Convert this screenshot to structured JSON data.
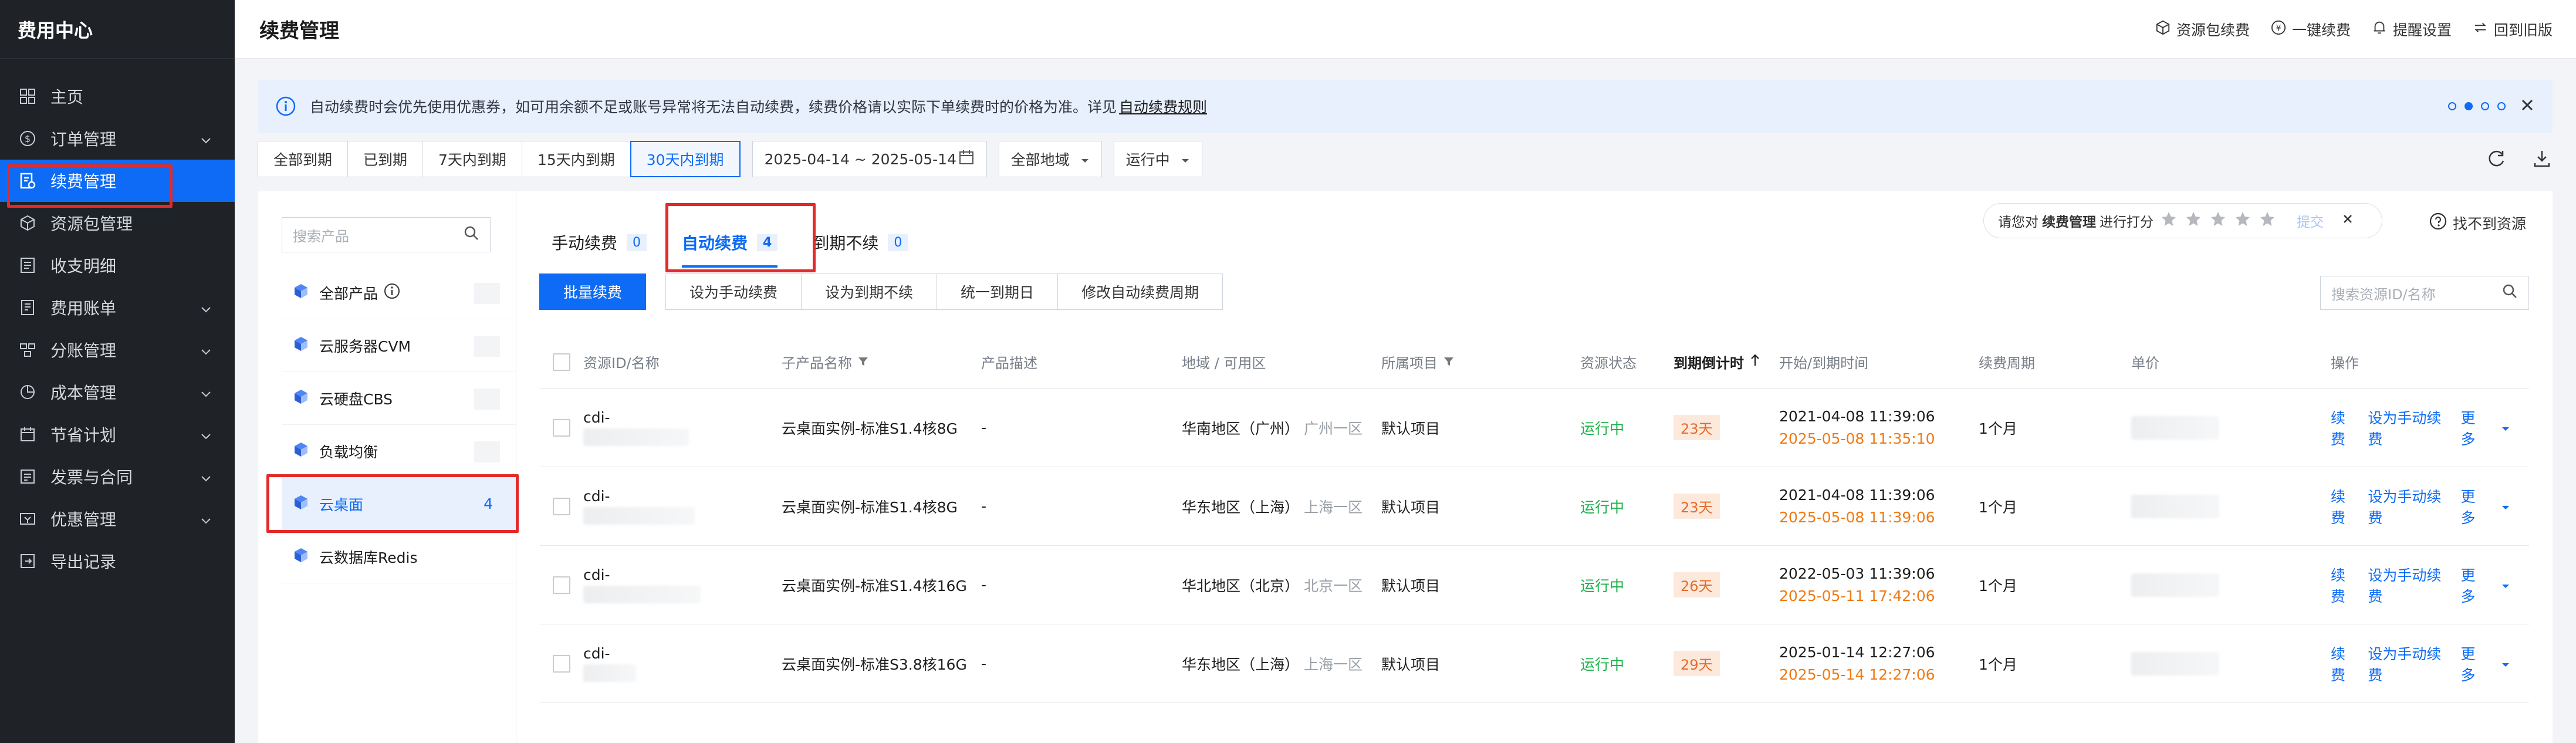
{
  "sidebar": {
    "title": "费用中心",
    "items": [
      {
        "label": "主页",
        "icon": "grid-icon",
        "chevron": false
      },
      {
        "label": "订单管理",
        "icon": "dollar-circle-icon",
        "chevron": true
      },
      {
        "label": "续费管理",
        "icon": "renew-doc-icon",
        "chevron": false,
        "active": true
      },
      {
        "label": "资源包管理",
        "icon": "cube-icon",
        "chevron": false
      },
      {
        "label": "收支明细",
        "icon": "list-icon",
        "chevron": false
      },
      {
        "label": "费用账单",
        "icon": "bill-icon",
        "chevron": true
      },
      {
        "label": "分账管理",
        "icon": "split-icon",
        "chevron": true
      },
      {
        "label": "成本管理",
        "icon": "pie-icon",
        "chevron": true
      },
      {
        "label": "节省计划",
        "icon": "calendar-icon",
        "chevron": true
      },
      {
        "label": "发票与合同",
        "icon": "invoice-icon",
        "chevron": true
      },
      {
        "label": "优惠管理",
        "icon": "coupon-icon",
        "chevron": true
      },
      {
        "label": "导出记录",
        "icon": "export-icon",
        "chevron": false
      }
    ]
  },
  "header": {
    "title": "续费管理",
    "actions": [
      {
        "label": "资源包续费",
        "icon": "cube-icon"
      },
      {
        "label": "一键续费",
        "icon": "coin-icon"
      },
      {
        "label": "提醒设置",
        "icon": "bell-icon"
      },
      {
        "label": "回到旧版",
        "icon": "switch-icon"
      }
    ]
  },
  "notice": {
    "text": "自动续费时会优先使用优惠券，如可用余额不足或账号异常将无法自动续费，续费价格请以实际下单续费时的价格为准。详见",
    "link": "自动续费规则"
  },
  "filters": {
    "periods": [
      "全部到期",
      "已到期",
      "7天内到期",
      "15天内到期",
      "30天内到期"
    ],
    "active_period": 4,
    "date_range": "2025-04-14  ~ 2025-05-14",
    "region": "全部地域",
    "status": "运行中"
  },
  "products": {
    "search_placeholder": "搜索产品",
    "items": [
      {
        "label": "全部产品",
        "count": ""
      },
      {
        "label": "云服务器CVM",
        "count": ""
      },
      {
        "label": "云硬盘CBS",
        "count": ""
      },
      {
        "label": "负载均衡",
        "count": ""
      },
      {
        "label": "云桌面",
        "count": "4",
        "selected": true
      },
      {
        "label": "云数据库Redis",
        "count": ""
      }
    ]
  },
  "tabs": [
    {
      "label": "手动续费",
      "count": "0"
    },
    {
      "label": "自动续费",
      "count": "4",
      "active": true
    },
    {
      "label": "到期不续",
      "count": "0"
    }
  ],
  "rating": {
    "prefix": "请您对",
    "subject": "续费管理",
    "suffix": "进行打分",
    "submit": "提交"
  },
  "missing_resource": "找不到资源",
  "buttons": [
    "批量续费",
    "设为手动续费",
    "设为到期不续",
    "统一到期日",
    "修改自动续费周期"
  ],
  "resource_search_placeholder": "搜索资源ID/名称",
  "table": {
    "headers": [
      "资源ID/名称",
      "子产品名称",
      "产品描述",
      "地域 / 可用区",
      "所属项目",
      "资源状态",
      "到期倒计时",
      "开始/到期时间",
      "续费周期",
      "单价",
      "操作"
    ],
    "rows": [
      {
        "id": "cdi-",
        "product": "云桌面实例-标准S1.4核8G",
        "desc": "-",
        "region": "华南地区（广州）",
        "zone": "广州一区",
        "project": "默认项目",
        "status": "运行中",
        "countdown": "23天",
        "start": "2021-04-08 11:39:06",
        "end": "2025-05-08 11:35:10",
        "cycle": "1个月"
      },
      {
        "id": "cdi-",
        "product": "云桌面实例-标准S1.4核8G",
        "desc": "-",
        "region": "华东地区（上海）",
        "zone": "上海一区",
        "project": "默认项目",
        "status": "运行中",
        "countdown": "23天",
        "start": "2021-04-08 11:39:06",
        "end": "2025-05-08 11:39:06",
        "cycle": "1个月"
      },
      {
        "id": "cdi-",
        "product": "云桌面实例-标准S1.4核16G",
        "desc": "-",
        "region": "华北地区（北京）",
        "zone": "北京一区",
        "project": "默认项目",
        "status": "运行中",
        "countdown": "26天",
        "start": "2022-05-03 11:39:06",
        "end": "2025-05-11 17:42:06",
        "cycle": "1个月"
      },
      {
        "id": "cdi-",
        "product": "云桌面实例-标准S3.8核16G",
        "desc": "-",
        "region": "华东地区（上海）",
        "zone": "上海一区",
        "project": "默认项目",
        "status": "运行中",
        "countdown": "29天",
        "start": "2025-01-14 12:27:06",
        "end": "2025-05-14 12:27:06",
        "cycle": "1个月"
      }
    ],
    "ops": {
      "renew": "续费",
      "set_manual": "设为手动续费",
      "more": "更多"
    }
  },
  "colors": {
    "accent": "#0d6bf5",
    "highlight": "#e22a2a",
    "running": "#1cb04a",
    "countdown": "#e56a2a"
  }
}
